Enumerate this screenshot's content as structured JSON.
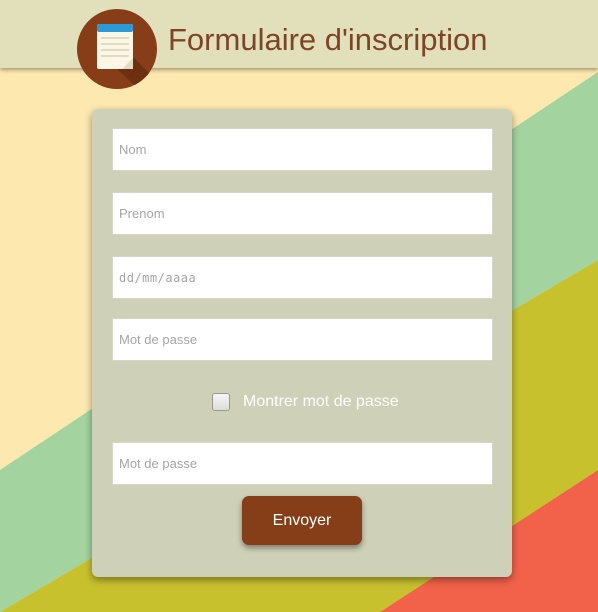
{
  "header": {
    "title": "Formulaire d'inscription",
    "logo_icon": "notepad-icon"
  },
  "form": {
    "nom_placeholder": "Nom",
    "prenom_placeholder": "Prenom",
    "date_placeholder": "dd/mm/aaaa",
    "password_placeholder": "Mot de passe",
    "show_password_label": "Montrer mot de passe",
    "show_password_checked": false,
    "confirm_password_placeholder": "Mot de passe",
    "submit_label": "Envoyer"
  },
  "colors": {
    "background_yellow": "#fde8b0",
    "stripe_green": "#a3d4a0",
    "stripe_olive": "#c8c12e",
    "stripe_coral": "#f2624a",
    "header_bg": "#e2dfbb",
    "card_bg": "#cfd0b8",
    "accent_brown": "#853e18"
  }
}
